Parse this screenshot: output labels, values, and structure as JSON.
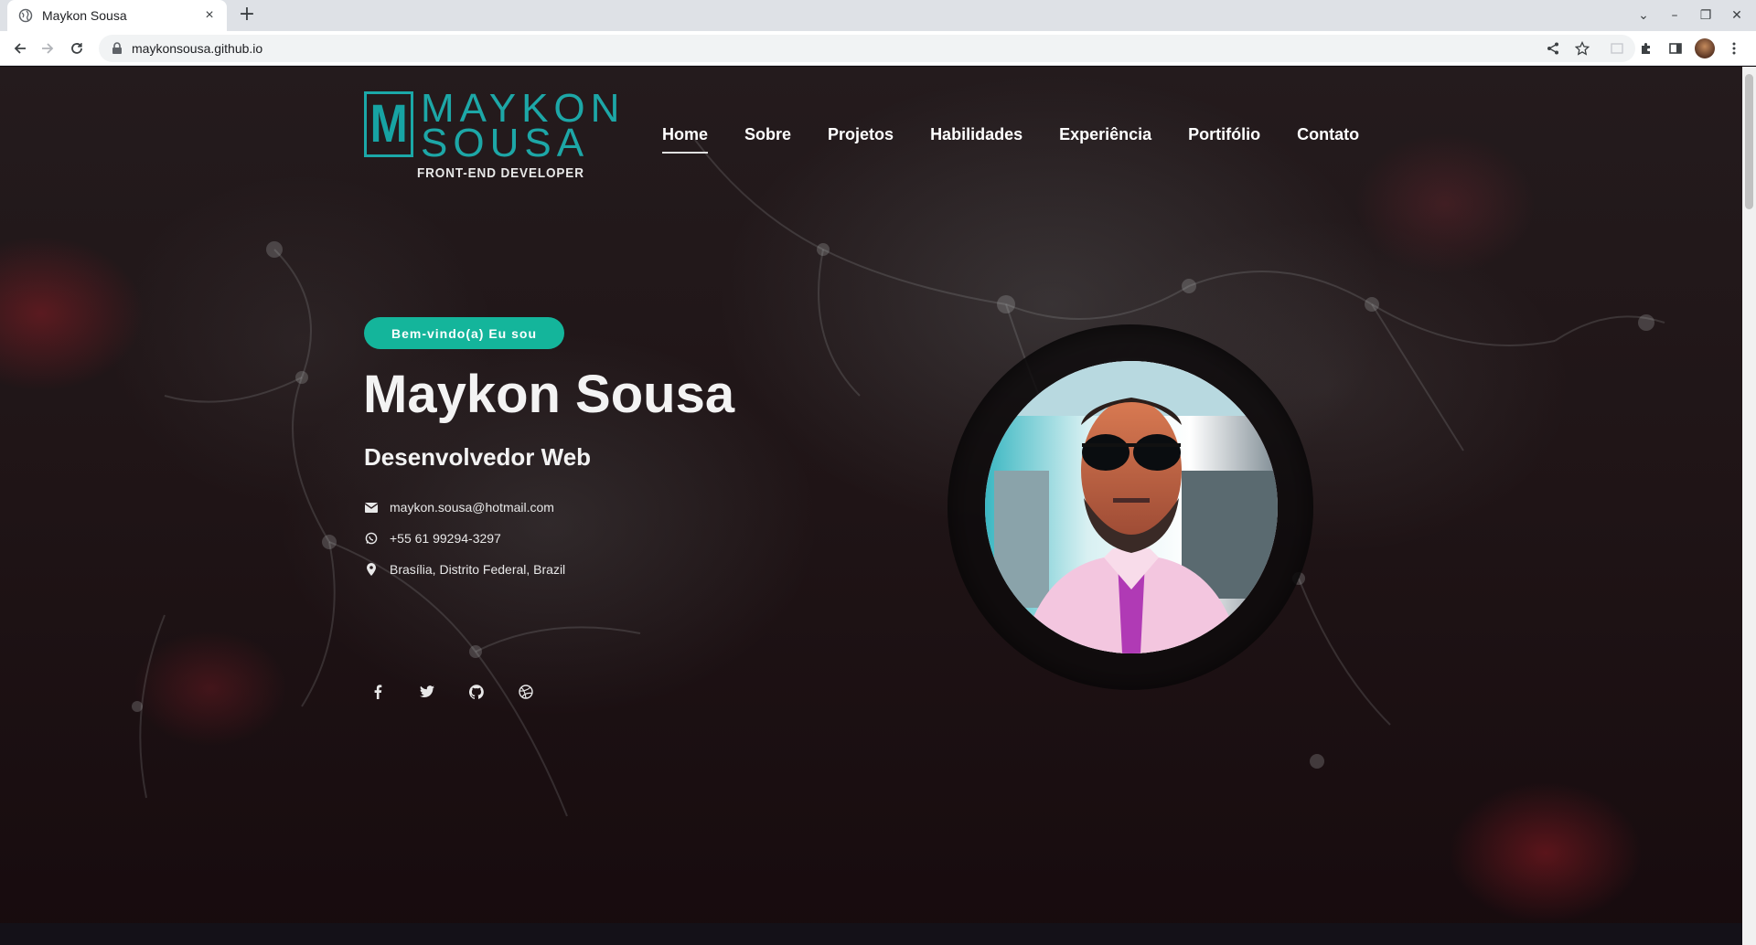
{
  "browser": {
    "tab_title": "Maykon Sousa",
    "tab_close": "×",
    "new_tab": "+",
    "url": "maykonsousa.github.io",
    "window_controls": [
      "⌄",
      "–",
      "❐",
      "✕"
    ]
  },
  "site": {
    "logo": {
      "mark": "M",
      "line1": "MAYKON",
      "line2": "SOUSA",
      "tagline": "FRONT-END DEVELOPER"
    },
    "nav": [
      {
        "label": "Home",
        "active": true
      },
      {
        "label": "Sobre",
        "active": false
      },
      {
        "label": "Projetos",
        "active": false
      },
      {
        "label": "Habilidades",
        "active": false
      },
      {
        "label": "Experiência",
        "active": false
      },
      {
        "label": "Portifólio",
        "active": false
      },
      {
        "label": "Contato",
        "active": false
      }
    ],
    "hero": {
      "badge": "Bem-vindo(a) Eu sou",
      "name": "Maykon Sousa",
      "role": "Desenvolvedor Web",
      "email": "maykon.sousa@hotmail.com",
      "phone": "+55 61 99294-3297",
      "location": "Brasília, Distrito Federal, Brazil"
    },
    "socials": [
      "facebook-icon",
      "twitter-icon",
      "github-icon",
      "dribbble-icon"
    ],
    "colors": {
      "accent": "#14b59b",
      "logo_teal": "#1da7a7",
      "background": "#1f1416"
    }
  }
}
